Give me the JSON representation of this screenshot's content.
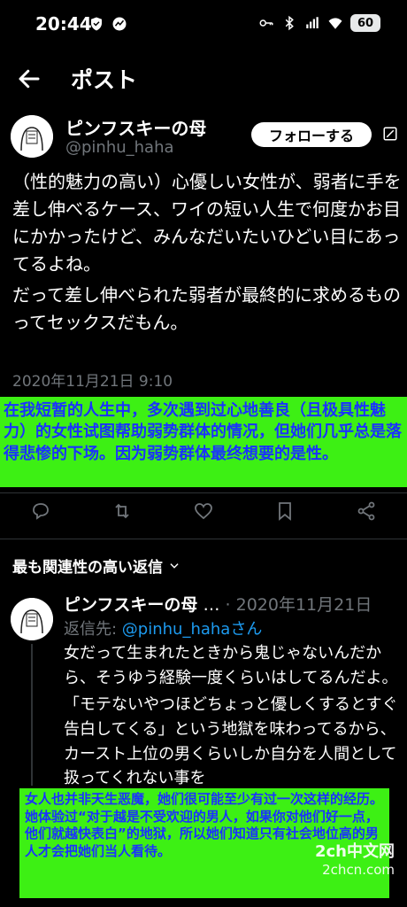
{
  "status_bar": {
    "time": "20:44",
    "battery": "60"
  },
  "top_bar": {
    "title": "ポスト"
  },
  "post": {
    "author_name": "ピンフスキーの母",
    "author_handle": "@pinhu_haha",
    "follow_label": "フォローする",
    "paragraphs": [
      "（性的魅力の高い）心優しい女性が、弱者に手を差し伸べるケース、ワイの短い人生で何度かお目にかかったけど、みんなだいたいひどい目にあってるよね。",
      "だって差し伸べられた弱者が最終的に求めるものってセックスだもん。"
    ],
    "timestamp": "2020年11月21日 9:10"
  },
  "overlay_top": "在我短暂的人生中，多次遇到过心地善良（且极具性魅力）的女性试图帮助弱势群体的情况，但她们几乎总是落得悲惨的下场。因为弱势群体最终想要的是性。",
  "relevant_label": "最も関連性の高い返信",
  "reply": {
    "author_name": "ピンフスキーの母",
    "ellipsis": "…",
    "date": "· 2020年11月21日",
    "reply_to_prefix": "返信先: ",
    "reply_to_handle": "@pinhu_hahaさん",
    "paragraphs": [
      "女だって生まれたときから鬼じゃないんだから、そうゆう経験一度くらいはしてるんだよ。",
      "「モテないやつほどちょっと優しくするとすぐ告白してくる」という地獄を味わってるから、カースト上位の男くらいしか自分を人間として扱ってくれない事を"
    ]
  },
  "overlay_bottom": [
    "女人也并非天生恶魔，她们很可能至少有过一次这样的经历。",
    "她体验过“对于越是不受欢迎的男人，如果你对他们好一点，他们就越快表白”的地狱，所以她们知道只有社会地位高的男人才会把她们当人看待。"
  ],
  "watermark": {
    "line1": "2ch中文网",
    "line2": "2chcn.com"
  },
  "colors": {
    "background": "#000000",
    "text": "#ffffff",
    "muted": "#71767b",
    "link": "#1d9bf0",
    "overlay_bg": "#3df014",
    "overlay_text": "#1a32ff"
  }
}
